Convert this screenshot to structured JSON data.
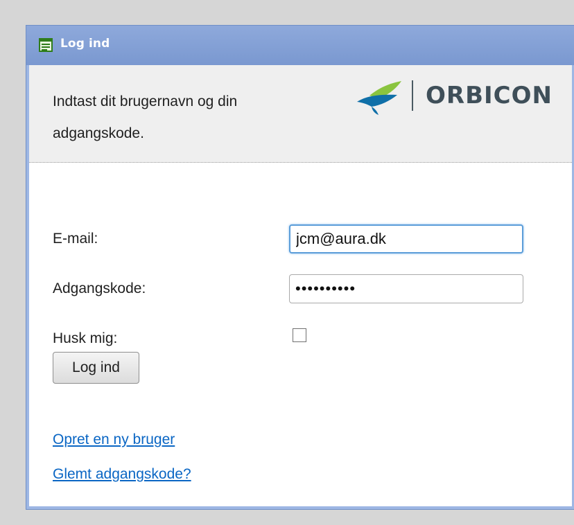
{
  "dialog": {
    "title": "Log ind",
    "title_icon": "window-form-icon"
  },
  "header": {
    "instructions": "Indtast dit brugernavn og din adgangskode.",
    "brand_name": "ORBICON"
  },
  "form": {
    "email_label": "E-mail:",
    "email_value": "jcm@aura.dk",
    "password_label": "Adgangskode:",
    "password_value": "••••••••••",
    "remember_label": "Husk mig:",
    "remember_checked": false,
    "submit_label": "Log ind"
  },
  "links": {
    "create_user": "Opret en ny bruger",
    "forgot_password": "Glemt adgangskode?"
  },
  "colors": {
    "title_bar": "#7f9ed6",
    "link": "#0a66c4",
    "brand_green": "#8ac43f",
    "brand_blue": "#0f6fa8"
  }
}
